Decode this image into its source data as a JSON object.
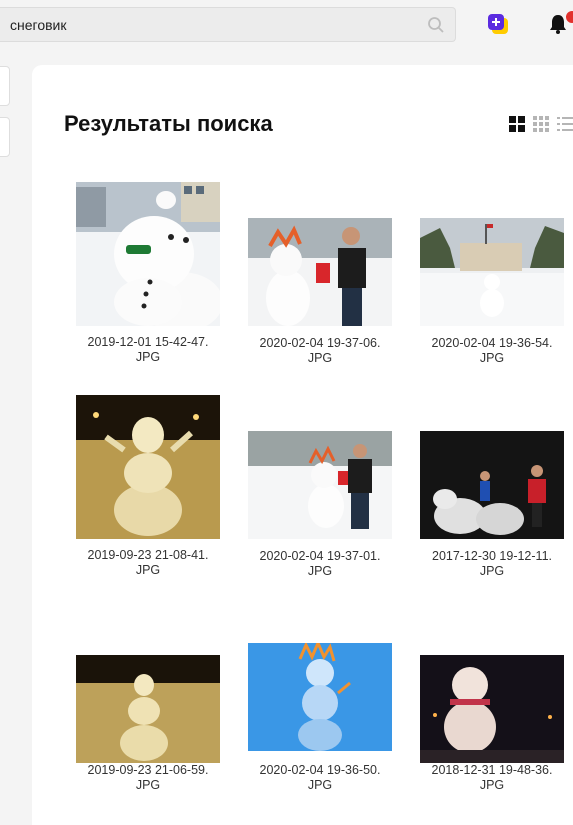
{
  "search": {
    "value": "снеговик"
  },
  "header": {
    "create_label": "+"
  },
  "page": {
    "title": "Результаты поиска"
  },
  "results": [
    {
      "name1": "2019-12-01 15-42-47.",
      "name2": "JPG"
    },
    {
      "name1": "2020-02-04 19-37-06.",
      "name2": "JPG"
    },
    {
      "name1": "2020-02-04 19-36-54.",
      "name2": "JPG"
    },
    {
      "name1": "2019-09-23 21-08-41.",
      "name2": "JPG"
    },
    {
      "name1": "2020-02-04 19-37-01.",
      "name2": "JPG"
    },
    {
      "name1": "2017-12-30 19-12-11.",
      "name2": "JPG"
    },
    {
      "name1": "2019-09-23 21-06-59.",
      "name2": "JPG"
    },
    {
      "name1": "2020-02-04 19-36-50.",
      "name2": "JPG"
    },
    {
      "name1": "2018-12-31 19-48-36.",
      "name2": "JPG"
    }
  ],
  "colors": {
    "accent": "#ffcc00",
    "badge": "#e2312d",
    "brand_purple": "#5b2be0"
  }
}
